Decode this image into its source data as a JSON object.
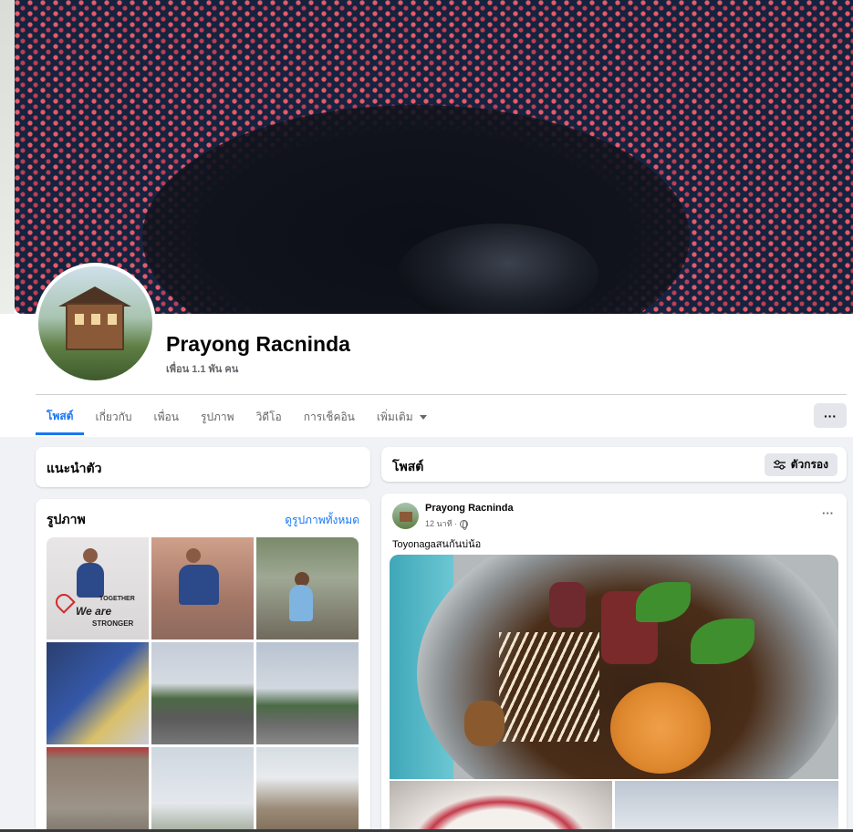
{
  "profile": {
    "name": "Prayong Racninda",
    "friends": "เพื่อน 1.1 พัน คน"
  },
  "tabs": [
    {
      "label": "โพสต์",
      "active": true
    },
    {
      "label": "เกี่ยวกับ",
      "active": false
    },
    {
      "label": "เพื่อน",
      "active": false
    },
    {
      "label": "รูปภาพ",
      "active": false
    },
    {
      "label": "วิดีโอ",
      "active": false
    },
    {
      "label": "การเช็คอิน",
      "active": false
    },
    {
      "label": "เพิ่มเติม",
      "active": false
    }
  ],
  "more_button": "···",
  "intro": {
    "title": "แนะนำตัว"
  },
  "photos": {
    "title": "รูปภาพ",
    "see_all": "ดูรูปภาพทั้งหมด",
    "photo1_text": {
      "together": "TOGETHER",
      "we_are": "We are",
      "stronger": "STRONGER"
    }
  },
  "posts_header": {
    "title": "โพสต์",
    "filter_label": "ตัวกรอง"
  },
  "post": {
    "author": "Prayong Racninda",
    "time": "12 นาที ·",
    "text": "Toyonagaสนกันบ่น้อ",
    "menu": "···"
  },
  "colors": {
    "accent": "#1877f2",
    "page_bg": "#f0f2f5",
    "secondary_text": "#65676b"
  }
}
